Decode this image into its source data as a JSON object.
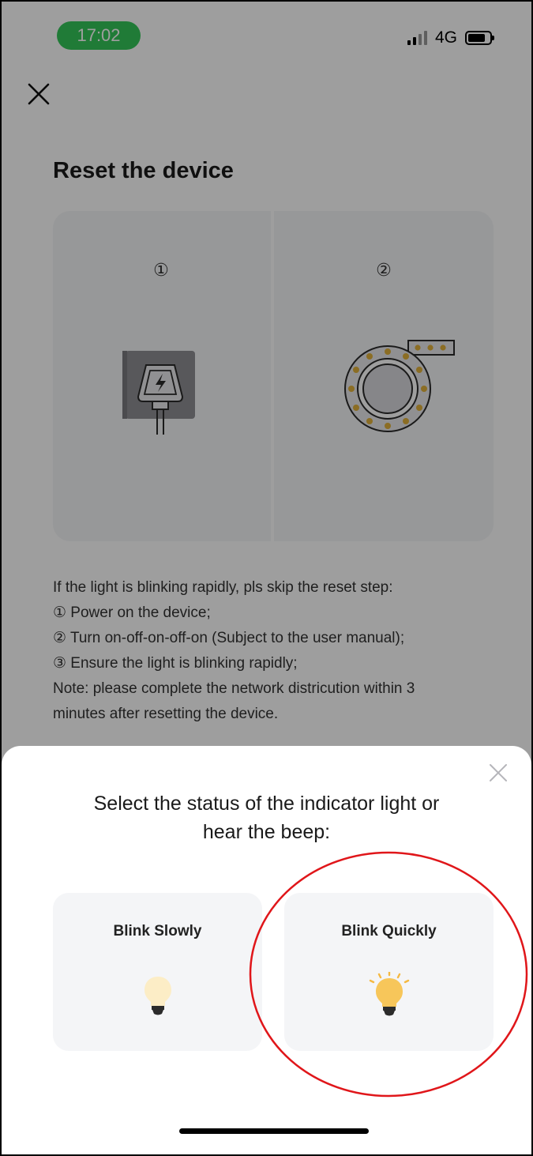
{
  "status_bar": {
    "time": "17:02",
    "network": "4G",
    "icons": [
      "signal-icon",
      "battery-icon"
    ],
    "pill_color": "#34c759"
  },
  "page": {
    "title": "Reset the device",
    "steps": [
      "①",
      "②"
    ],
    "instructions": [
      "If the light is blinking rapidly, pls skip the reset step:",
      "①  Power on the device;",
      "②  Turn on-off-on-off-on (Subject to the user manual);",
      "③  Ensure the light is blinking rapidly;",
      "Note: please complete the network districution within 3",
      "minutes after resetting the device."
    ]
  },
  "sheet": {
    "title_line1": "Select the status of the indicator light or",
    "title_line2": "hear the beep:",
    "options": [
      {
        "label": "Blink Slowly",
        "icon": "bulb-dim-icon"
      },
      {
        "label": "Blink Quickly",
        "icon": "bulb-glowing-icon"
      }
    ]
  },
  "colors": {
    "accent_green": "#34c759",
    "highlight_red": "#e0161a",
    "card_bg": "#f4f5f7",
    "bulb_gold": "#f5b942"
  }
}
